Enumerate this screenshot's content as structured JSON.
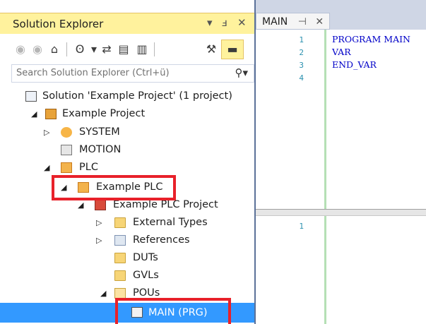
{
  "explorer": {
    "title": "Solution Explorer",
    "search_placeholder": "Search Solution Explorer (Ctrl+ü)",
    "tree": [
      {
        "label": "Solution 'Example Project' (1 project)",
        "icon": "solution-icon",
        "arrow": ""
      },
      {
        "label": "Example Project",
        "icon": "project-icon",
        "arrow": "◢"
      },
      {
        "label": "SYSTEM",
        "icon": "system-icon",
        "arrow": "▷"
      },
      {
        "label": "MOTION",
        "icon": "motion-icon",
        "arrow": ""
      },
      {
        "label": "PLC",
        "icon": "plc-icon",
        "arrow": "◢"
      },
      {
        "label": "Example PLC",
        "icon": "plc-icon",
        "arrow": "◢"
      },
      {
        "label": "Example PLC Project",
        "icon": "plc-project-icon",
        "arrow": "◢"
      },
      {
        "label": "External Types",
        "icon": "folder-icon",
        "arrow": "▷"
      },
      {
        "label": "References",
        "icon": "references-icon",
        "arrow": "▷"
      },
      {
        "label": "DUTs",
        "icon": "folder-icon",
        "arrow": ""
      },
      {
        "label": "GVLs",
        "icon": "folder-icon",
        "arrow": ""
      },
      {
        "label": "POUs",
        "icon": "folder-open-icon",
        "arrow": "◢"
      },
      {
        "label": "MAIN (PRG)",
        "icon": "program-icon",
        "arrow": ""
      }
    ]
  },
  "editor": {
    "tab_label": "MAIN",
    "top_lines": [
      "PROGRAM MAIN",
      "VAR",
      "END_VAR",
      ""
    ],
    "bottom_lines": [
      ""
    ]
  },
  "colors": {
    "selection": "#3399ff",
    "highlight_box": "#e8212a",
    "title_active": "#fff29d",
    "code_keyword": "#0000c8"
  }
}
